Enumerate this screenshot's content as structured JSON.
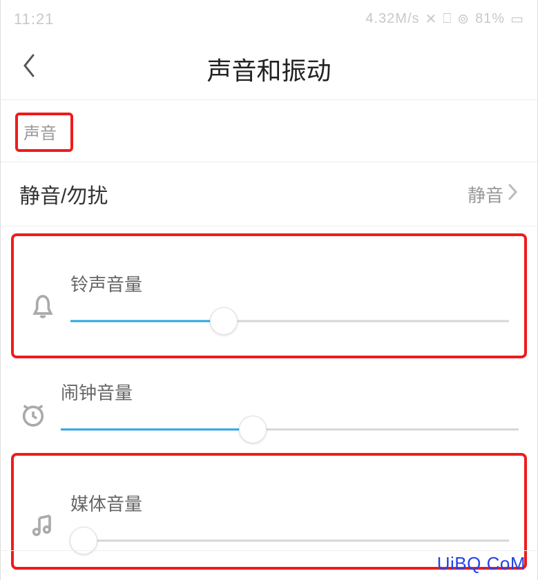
{
  "status_bar": {
    "time": "11:21",
    "net_speed": "4.32M/s",
    "battery_pct": "81%"
  },
  "header": {
    "title": "声音和振动"
  },
  "section": {
    "label": "声音"
  },
  "dnd_row": {
    "label": "静音/勿扰",
    "value": "静音"
  },
  "sliders": {
    "ring": {
      "label": "铃声音量",
      "percent": 35
    },
    "alarm": {
      "label": "闹钟音量",
      "percent": 42
    },
    "media": {
      "label": "媒体音量",
      "percent": 3
    }
  },
  "watermark": "UiBQ.CoM"
}
